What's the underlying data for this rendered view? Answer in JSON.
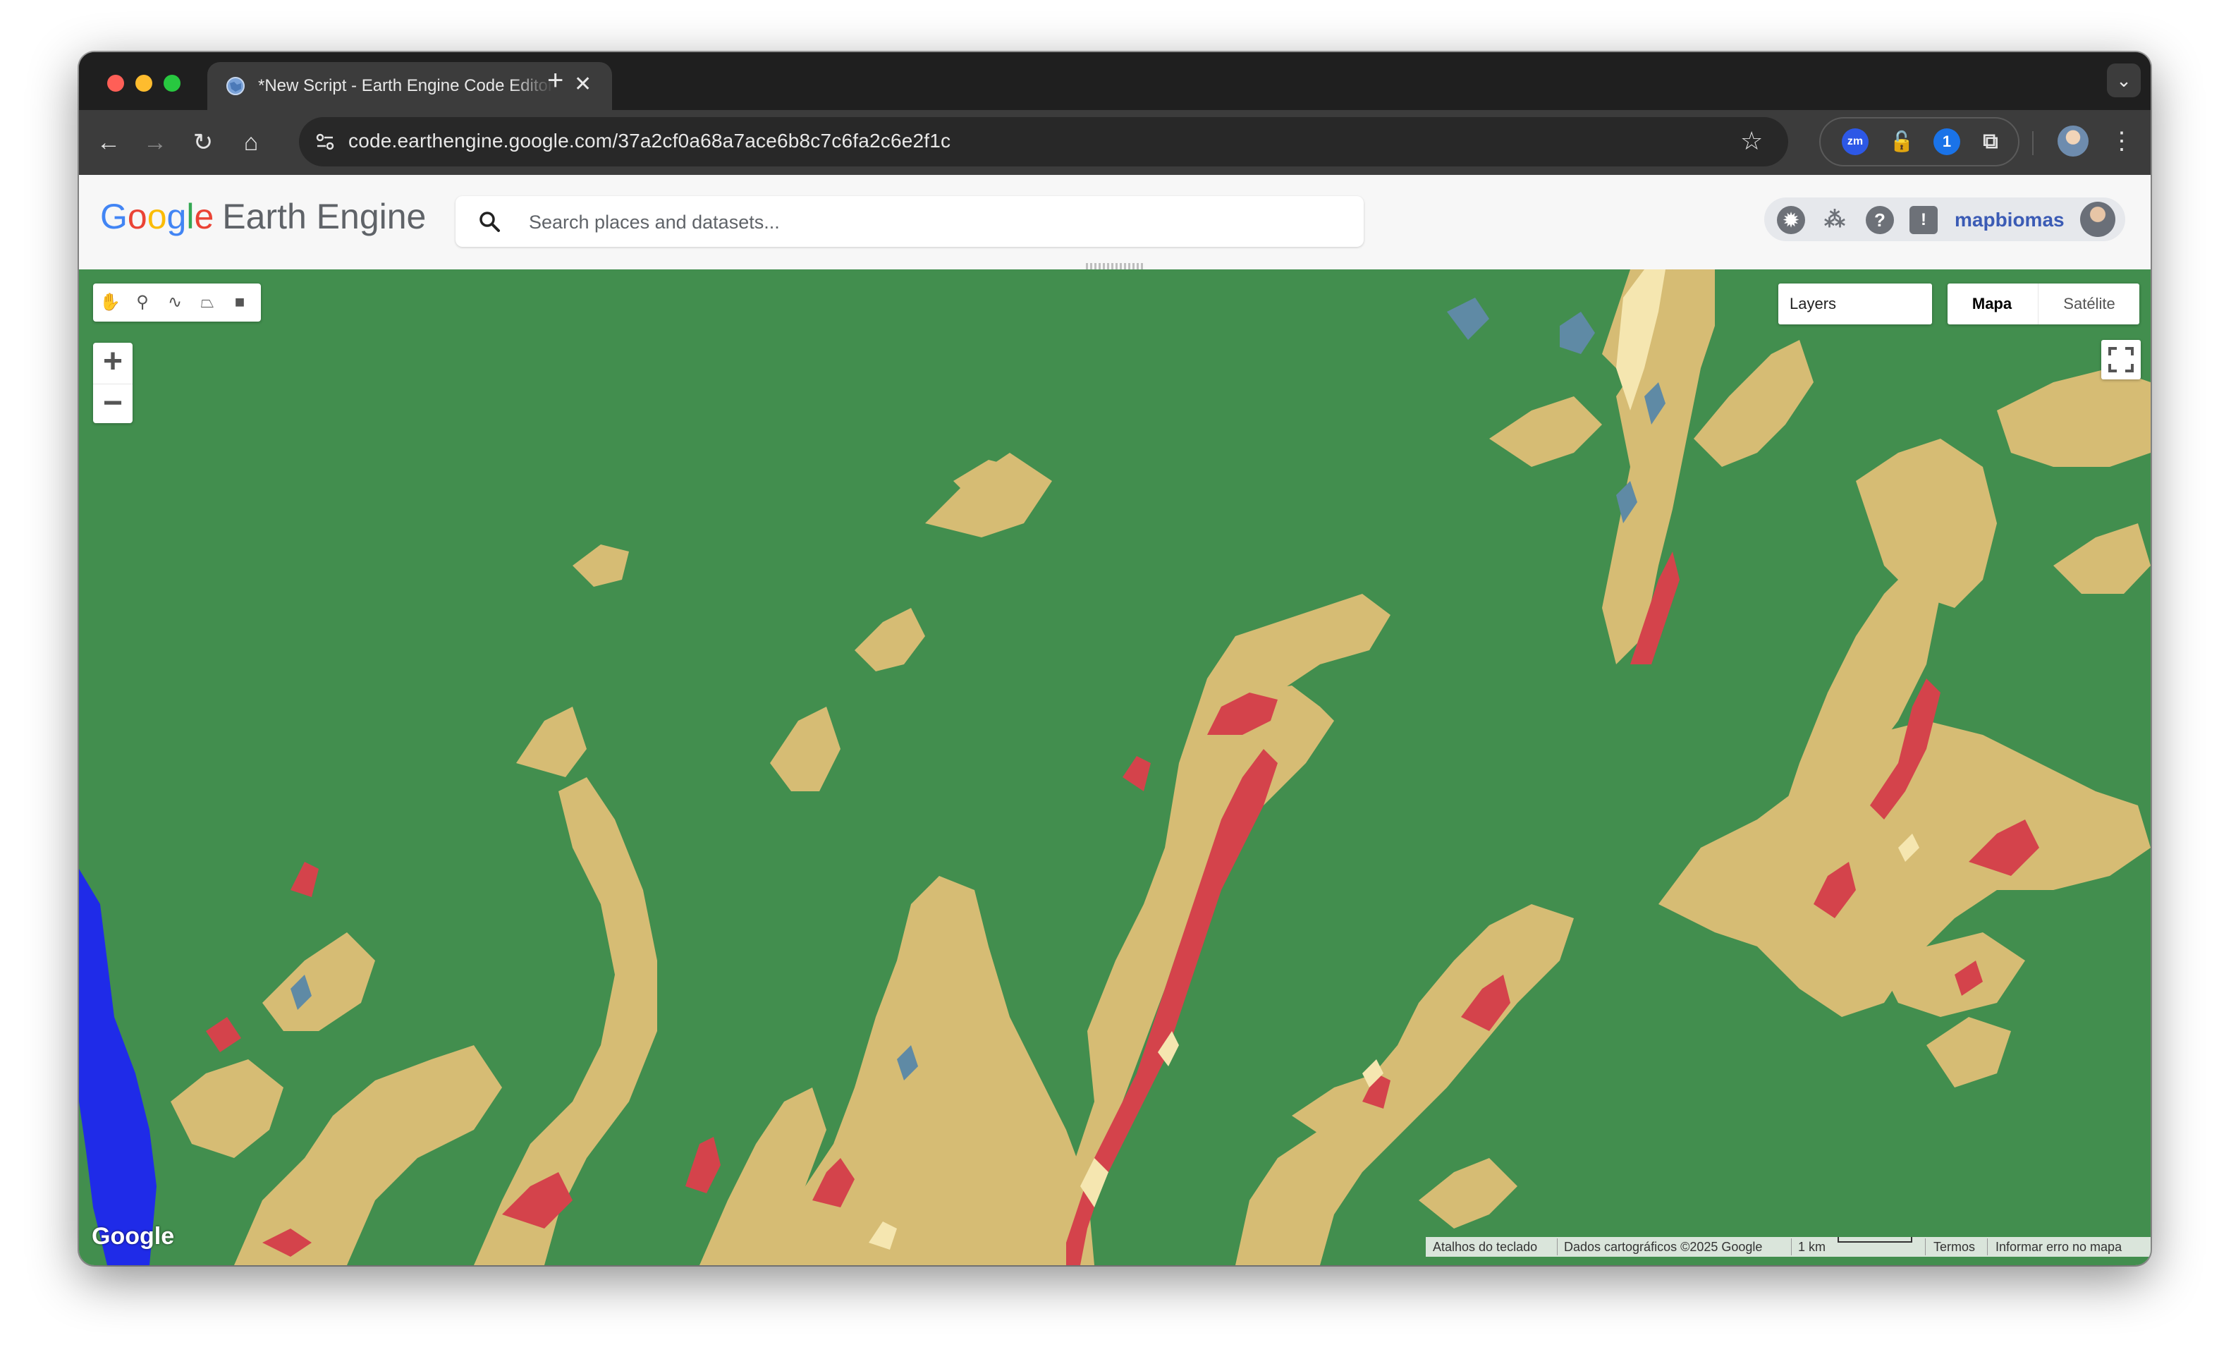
{
  "browser": {
    "tab_title": "*New Script - Earth Engine Code Editor",
    "new_tab_symbol": "+",
    "tab_close_symbol": "✕",
    "tab_search_symbol": "⌄",
    "url": "code.earthengine.google.com/37a2cf0a68a7ace6b8c7c6fa2c6e2f1c",
    "nav": {
      "back": "←",
      "forward": "→",
      "reload": "↻",
      "home": "⌂"
    },
    "bookmark_star": "☆",
    "extensions": [
      {
        "name": "zoom-extension-icon",
        "label": "zm"
      },
      {
        "name": "lock-extension-icon",
        "label": "🔓"
      },
      {
        "name": "onepassword-extension-icon",
        "label": "1"
      },
      {
        "name": "puzzle-extensions-icon",
        "label": "⧉"
      }
    ],
    "menu_symbol": "⋮"
  },
  "header": {
    "logo": {
      "g1": "G",
      "o1": "o",
      "o2": "o",
      "g2": "g",
      "l": "l",
      "e": "e",
      "product": "Earth Engine"
    },
    "search_placeholder": "Search places and datasets...",
    "icons": {
      "gear": "✹",
      "apps": "⁂",
      "help": "?",
      "feedback": "!"
    },
    "username": "mapbiomas"
  },
  "map": {
    "layers_label": "Layers",
    "map_types": [
      "Mapa",
      "Satélite"
    ],
    "selected_map_type": "Mapa",
    "zoom_in": "+",
    "zoom_out": "−",
    "drawing_tools": [
      "✋",
      "⚲",
      "∿",
      "⏢",
      "■"
    ],
    "google_mark": "Google",
    "attribution": {
      "shortcuts": "Atalhos do teclado",
      "data": "Dados cartográficos ©2025 Google",
      "scale": "1 km",
      "terms": "Termos",
      "report": "Informar erro no mapa"
    },
    "colors": {
      "forest": "#428e4e",
      "agriculture": "#d6bc74",
      "urban": "#d4434b",
      "non_vegetated": "#f5e6b0",
      "water_wetland": "#5f8aa5",
      "river": "#1f2be8"
    }
  }
}
